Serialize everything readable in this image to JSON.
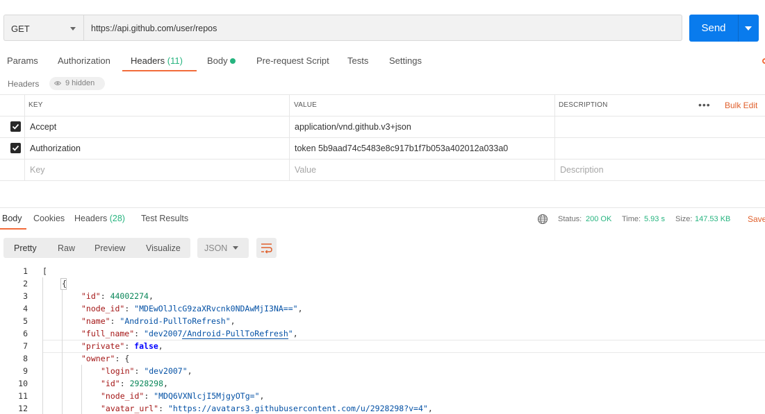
{
  "request": {
    "method": "GET",
    "url": "https://api.github.com/user/repos",
    "send_label": "Send"
  },
  "request_tabs": [
    {
      "label": "Params"
    },
    {
      "label": "Authorization"
    },
    {
      "label": "Headers",
      "count": "(11)"
    },
    {
      "label": "Body"
    },
    {
      "label": "Pre-request Script"
    },
    {
      "label": "Tests"
    },
    {
      "label": "Settings"
    }
  ],
  "headers_section": {
    "label": "Headers",
    "hidden_label": "9 hidden"
  },
  "headers_table": {
    "columns": [
      "KEY",
      "VALUE",
      "DESCRIPTION"
    ],
    "bulk_edit": "Bulk Edit",
    "rows": [
      {
        "enabled": true,
        "key": "Accept",
        "value": "application/vnd.github.v3+json",
        "description": ""
      },
      {
        "enabled": true,
        "key": "Authorization",
        "value": "token 5b9aad74c5483e8c917b1f7b053a402012a033a0",
        "description": ""
      }
    ],
    "placeholders": {
      "key": "Key",
      "value": "Value",
      "description": "Description"
    }
  },
  "response_tabs": [
    {
      "label": "Body"
    },
    {
      "label": "Cookies"
    },
    {
      "label": "Headers",
      "count": "(28)"
    },
    {
      "label": "Test Results"
    }
  ],
  "response_status": {
    "status_label": "Status:",
    "status_value": "200 OK",
    "time_label": "Time:",
    "time_value": "5.93 s",
    "size_label": "Size:",
    "size_value": "147.53 KB",
    "save_label": "Save"
  },
  "view_modes": [
    "Pretty",
    "Raw",
    "Preview",
    "Visualize"
  ],
  "format": "JSON",
  "code_lines": {
    "l1": {
      "num": "1",
      "open": "["
    },
    "l2": {
      "num": "2",
      "open": "{"
    },
    "l3": {
      "num": "3",
      "key": "\"id\"",
      "value": "44002274",
      "tail": ","
    },
    "l4": {
      "num": "4",
      "key": "\"node_id\"",
      "value": "\"MDEwOlJlcG9zaXRvcnk0NDAwMjI3NA==\"",
      "tail": ","
    },
    "l5": {
      "num": "5",
      "key": "\"name\"",
      "value": "\"Android-PullToRefresh\"",
      "tail": ","
    },
    "l6": {
      "num": "6",
      "key": "\"full_name\"",
      "value_a": "\"dev2007",
      "value_b": "/Android-PullToRefresh",
      "value_c": "\"",
      "tail": ","
    },
    "l7": {
      "num": "7",
      "key": "\"private\"",
      "value": "false",
      "tail": ","
    },
    "l8": {
      "num": "8",
      "key": "\"owner\"",
      "tail": "{"
    },
    "l9": {
      "num": "9",
      "key": "\"login\"",
      "value": "\"dev2007\"",
      "tail": ","
    },
    "l10": {
      "num": "10",
      "key": "\"id\"",
      "value": "2928298",
      "tail": ","
    },
    "l11": {
      "num": "11",
      "key": "\"node_id\"",
      "value": "\"MDQ6VXNlcjI5MjgyOTg=\"",
      "tail": ","
    },
    "l12": {
      "num": "12",
      "key": "\"avatar_url\"",
      "value": "\"https://avatars3.githubusercontent.com/u/2928298?v=4\"",
      "tail": ","
    }
  },
  "colors": {
    "accent": "#f26b3a",
    "send": "#097bed",
    "success": "#26b47f"
  },
  "icons": [
    "chevron-down-icon",
    "eye-icon",
    "checkbox-checked-icon",
    "more-horizontal-icon",
    "globe-icon",
    "wrap-lines-icon"
  ]
}
